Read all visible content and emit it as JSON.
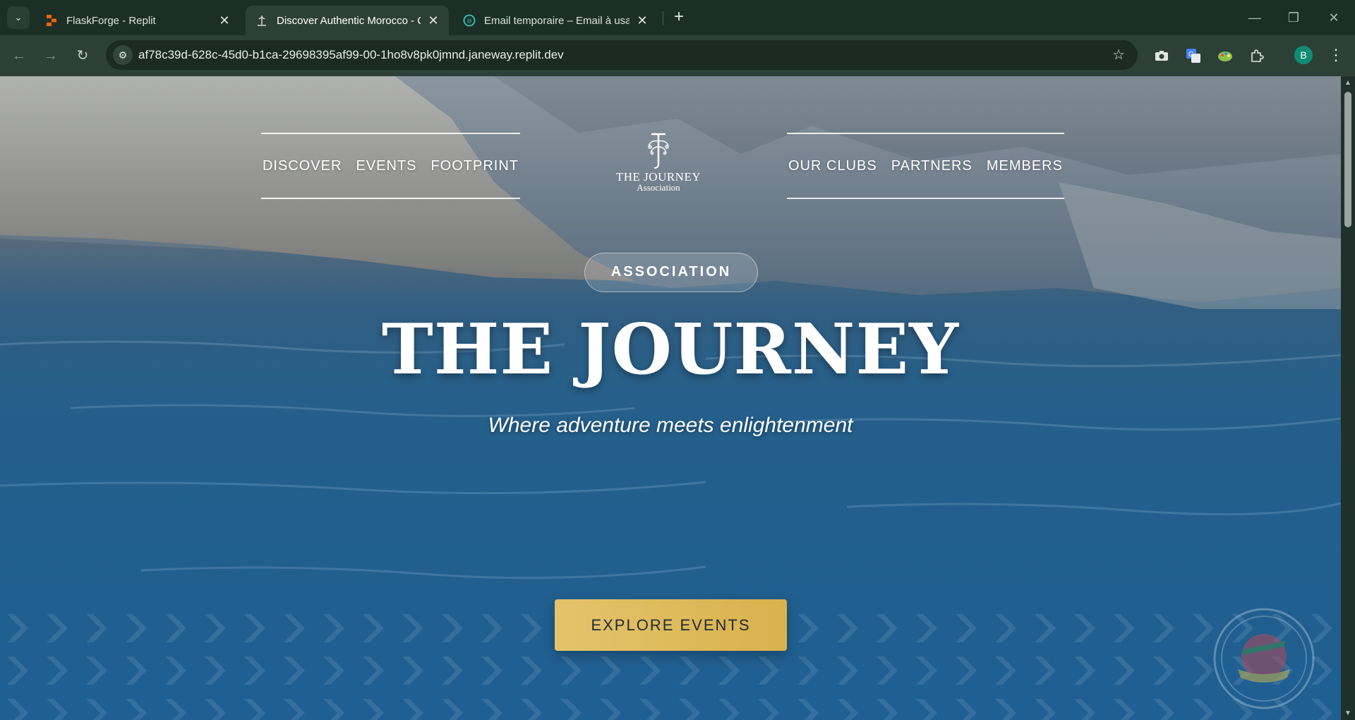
{
  "browser": {
    "tabs": [
      {
        "title": "FlaskForge - Replit",
        "icon": "replit-icon"
      },
      {
        "title": "Discover Authentic Morocco - C",
        "icon": "journey-icon",
        "active": true
      },
      {
        "title": "Email temporaire – Email à usag",
        "icon": "email-icon"
      }
    ],
    "url": "af78c39d-628c-45d0-b1ca-29698395af99-00-1ho8v8pk0jmnd.janeway.replit.dev",
    "profile_initial": "B"
  },
  "nav": {
    "left": [
      "DISCOVER",
      "EVENTS",
      "FOOTPRINT"
    ],
    "right": [
      "OUR CLUBS",
      "PARTNERS",
      "MEMBERS"
    ]
  },
  "logo": {
    "title": "THE JOURNEY",
    "subtitle": "Association"
  },
  "hero": {
    "badge": "ASSOCIATION",
    "title": "THE JOURNEY",
    "subtitle": "Where adventure meets enlightenment",
    "cta": "EXPLORE EVENTS"
  },
  "colors": {
    "accent_gold": "#d9b24c",
    "chrome_dark": "#1c2f27",
    "water_blue": "#2a6a9a"
  }
}
